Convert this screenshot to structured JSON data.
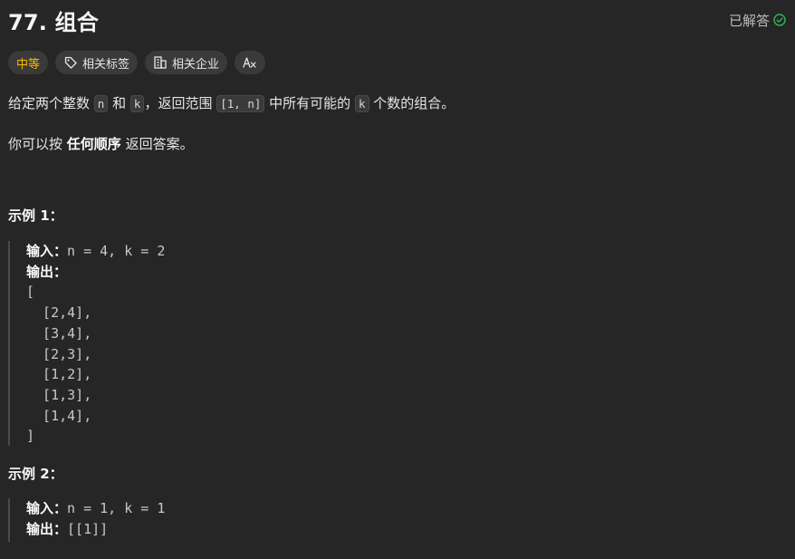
{
  "problem": {
    "title": "77. 组合",
    "status": "已解答"
  },
  "tags": {
    "difficulty": "中等",
    "related_tags": "相关标签",
    "related_companies": "相关企业"
  },
  "description": {
    "p1_part1": "给定两个整数",
    "n": "n",
    "and": "和",
    "k": "k",
    "p1_part2": "，返回范围",
    "range": "[1, n]",
    "p1_part3": "中所有可能的",
    "k2": "k",
    "p1_part4": "个数的组合。",
    "p2_part1": "你可以按",
    "p2_bold": "任何顺序",
    "p2_part2": "返回答案。"
  },
  "examples": [
    {
      "title": "示例 1：",
      "input_label": "输入：",
      "input_value": "n = 4, k = 2",
      "output_label": "输出：",
      "output_lines": [
        "[",
        "  [2,4],",
        "  [3,4],",
        "  [2,3],",
        "  [1,2],",
        "  [1,3],",
        "  [1,4],",
        "]"
      ]
    },
    {
      "title": "示例 2：",
      "input_label": "输入：",
      "input_value": "n = 1, k = 1",
      "output_label": "输出：",
      "output_value": "[[1]]"
    }
  ],
  "colors": {
    "background": "#262626",
    "difficulty_medium": "#ffb800",
    "solved_check": "#2db55d"
  },
  "icons": {
    "solved": "check-circle-icon",
    "tag": "tag-icon",
    "company": "building-icon",
    "translate": "translate-icon"
  }
}
